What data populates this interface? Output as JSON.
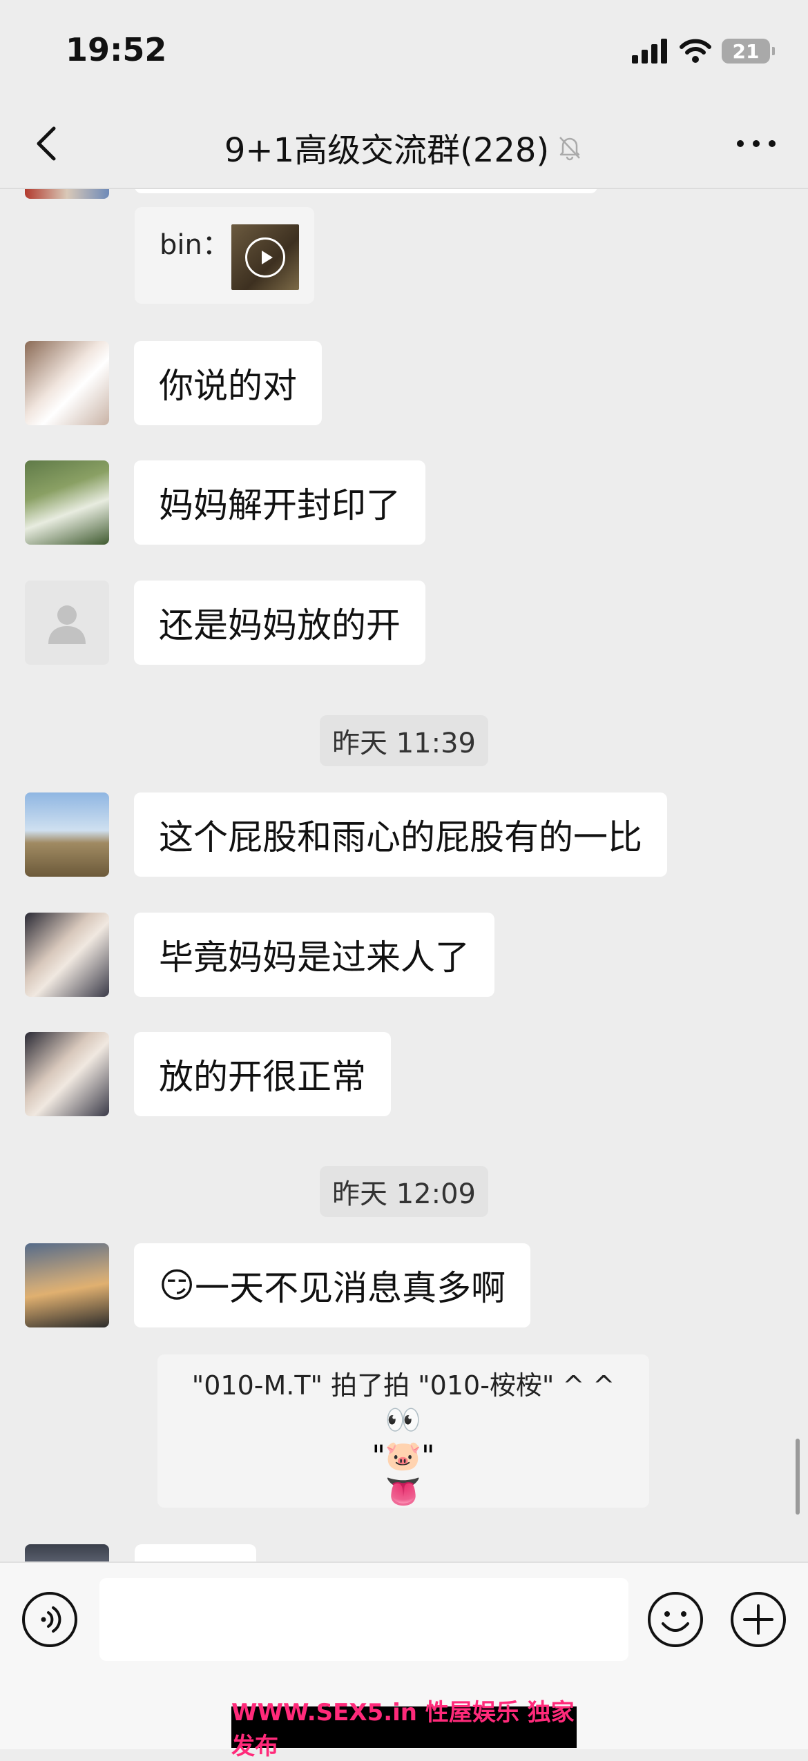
{
  "status_bar": {
    "time": "19:52",
    "battery": "21"
  },
  "nav": {
    "title": "9+1高级交流群(228)"
  },
  "chat": {
    "video_card": {
      "label": "bin："
    },
    "messages": [
      {
        "text": "你说的对"
      },
      {
        "text": "妈妈解开封印了"
      },
      {
        "text": "还是妈妈放的开"
      },
      {
        "text": "这个屁股和雨心的屁股有的一比"
      },
      {
        "text": "毕竟妈妈是过来人了"
      },
      {
        "text": "放的开很正常"
      },
      {
        "text": "一天不见消息真多啊",
        "emoji": "😏"
      }
    ],
    "timestamps": [
      "昨天 11:39",
      "昨天 12:09"
    ],
    "pat": {
      "text": "\"010-M.T\" 拍了拍 \"010-桉桉\" ^ ^",
      "eyes": "👀",
      "pig": "\"🐷\"",
      "tongue": "👅"
    }
  },
  "input": {
    "placeholder": ""
  },
  "watermark": {
    "text": "WWW.SEX5.in 性屋娱乐 独家发布"
  },
  "colors": {
    "background": "#ededed",
    "bubble": "#ffffff",
    "watermark_text": "#ff2a7a"
  }
}
